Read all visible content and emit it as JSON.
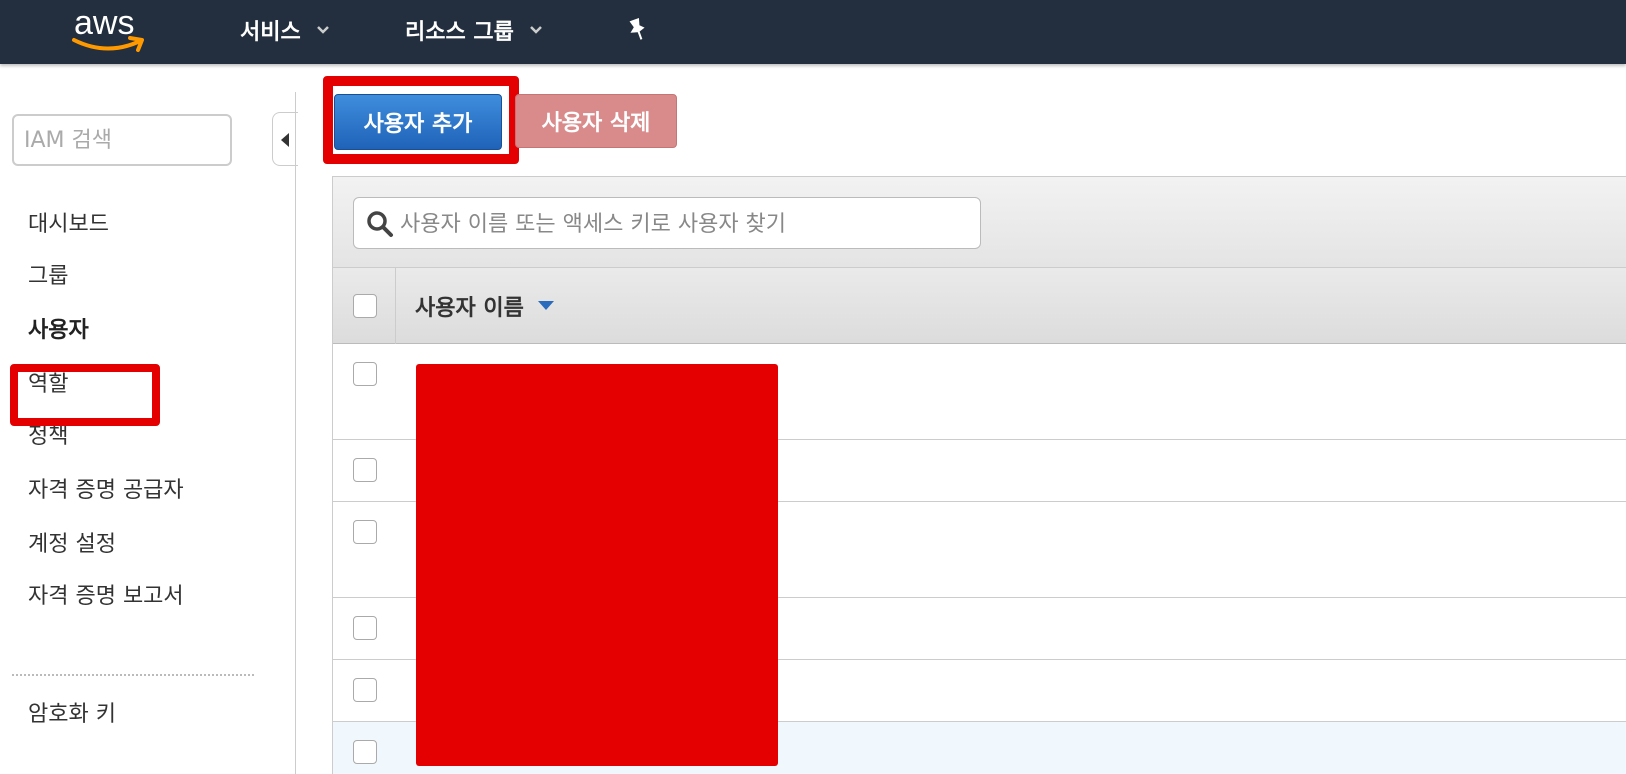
{
  "topbar": {
    "logo_text": "aws",
    "services_label": "서비스",
    "resource_groups_label": "리소스 그룹"
  },
  "sidebar": {
    "search_placeholder": "IAM 검색",
    "items": [
      {
        "label": "대시보드"
      },
      {
        "label": "그룹"
      },
      {
        "label": "사용자",
        "active": true
      },
      {
        "label": "역할"
      },
      {
        "label": "정책"
      },
      {
        "label": "자격 증명 공급자"
      },
      {
        "label": "계정 설정"
      },
      {
        "label": "자격 증명 보고서"
      }
    ],
    "bottom_items": [
      {
        "label": "암호화 키"
      }
    ]
  },
  "toolbar": {
    "add_user_label": "사용자 추가",
    "delete_user_label": "사용자 삭제"
  },
  "table": {
    "search_placeholder": "사용자 이름 또는 액세스 키로 사용자 찾기",
    "columns": [
      {
        "label": "사용자 이름",
        "sort": "descending"
      }
    ],
    "row_count": 6
  },
  "colors": {
    "topbar_bg": "#232f3e",
    "primary_button": "#2d7fd3",
    "disabled_danger_button": "#d98b8b",
    "highlight_red": "#e40000",
    "link_blue": "#2a6bbd"
  }
}
